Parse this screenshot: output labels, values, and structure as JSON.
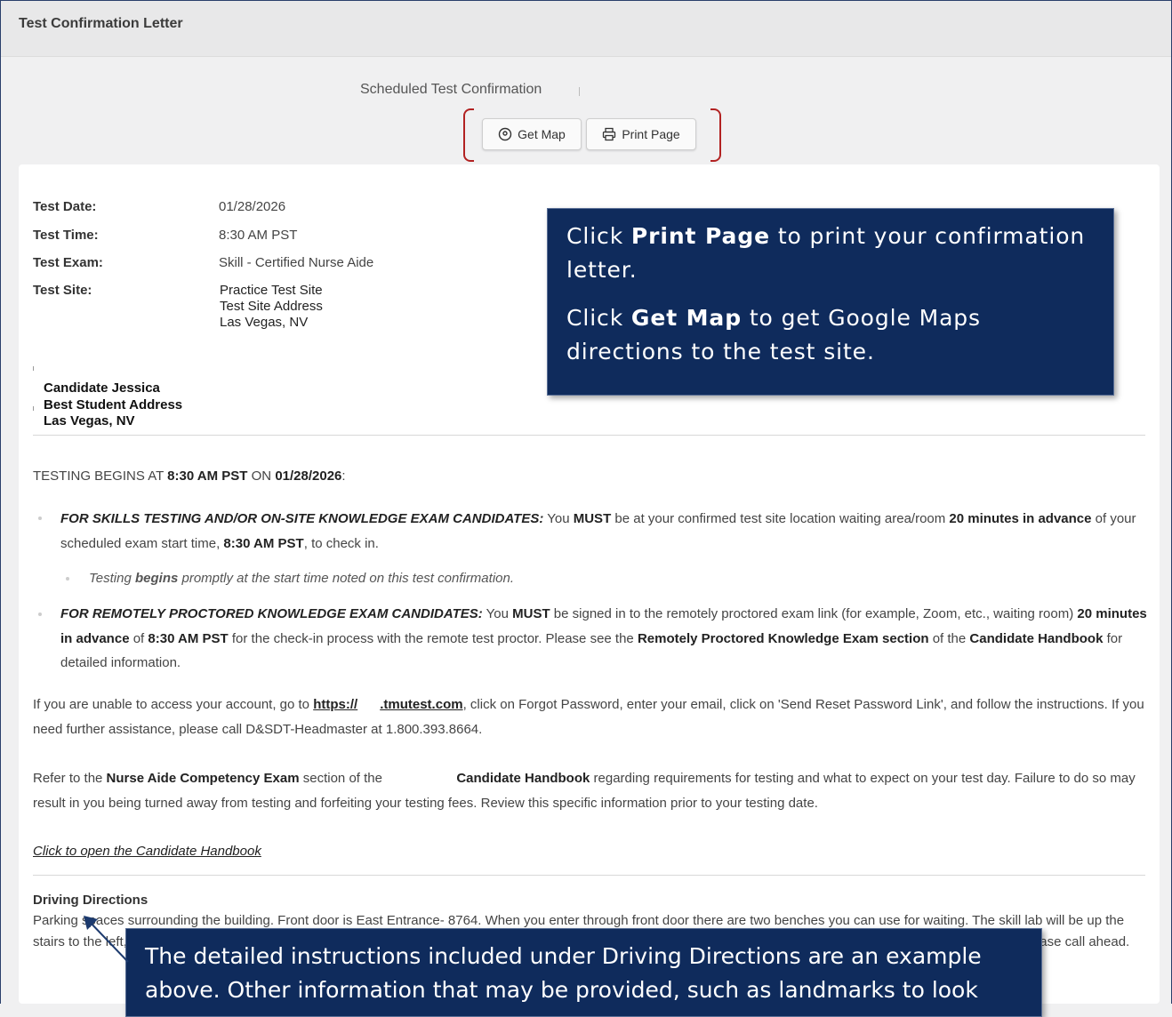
{
  "header": {
    "title": "Test Confirmation Letter"
  },
  "confirmation": {
    "subtitle": "Scheduled Test Confirmation",
    "get_map_label": "Get Map",
    "print_page_label": "Print Page"
  },
  "test_info": {
    "date_label": "Test Date:",
    "date_value": "01/28/2026",
    "time_label": "Test Time:",
    "time_value": "8:30 AM PST",
    "exam_label": "Test Exam:",
    "exam_value": "Skill - Certified Nurse Aide",
    "site_label": "Test Site:",
    "site_lines": [
      "Practice Test Site",
      "Test Site Address",
      "Las Vegas, NV"
    ]
  },
  "candidate": {
    "lines": [
      "Candidate Jessica",
      "Best Student Address",
      "Las Vegas, NV"
    ]
  },
  "testing": {
    "intro_prefix": "TESTING BEGINS AT ",
    "intro_time": "8:30 AM PST",
    "intro_mid": " ON ",
    "intro_date": "01/28/2026",
    "intro_suffix": ":",
    "b1_lead": "FOR SKILLS TESTING AND/OR ON-SITE KNOWLEDGE EXAM CANDIDATES:",
    "b1_t1": " You ",
    "b1_must": "MUST",
    "b1_t2": " be at your confirmed test site location waiting area/room ",
    "b1_adv": "20 minutes in advance",
    "b1_t3": " of your scheduled exam start time, ",
    "b1_time": "8:30 AM PST",
    "b1_t4": ", to check in.",
    "sub_t1": "Testing ",
    "sub_begins": "begins",
    "sub_t2": " promptly at the start time noted on this test confirmation.",
    "b2_lead": "FOR REMOTELY PROCTORED KNOWLEDGE EXAM CANDIDATES:",
    "b2_t1": " You ",
    "b2_must": "MUST",
    "b2_t2": " be signed in to the remotely proctored exam link (for example, Zoom, etc., waiting room) ",
    "b2_adv": "20 minutes in advance",
    "b2_t3": " of ",
    "b2_time": "8:30 AM PST",
    "b2_t4": " for the check-in process with the remote test proctor.  Please see the ",
    "b2_section": "Remotely Proctored Knowledge Exam section",
    "b2_t5": " of the ",
    "b2_handbook": "Candidate Handbook",
    "b2_t6": " for detailed information."
  },
  "account": {
    "t1": "If you are unable to access your account, go to ",
    "link1": "https://",
    "gap": "      ",
    "link2": ".tmutest.com",
    "t2": ", click on Forgot Password, enter your email, click on 'Send Reset Password Link', and follow the instructions.  If you need further assistance, please call D&SDT-Headmaster at 1.800.393.8664."
  },
  "refer": {
    "t1": "Refer to the ",
    "b1": "Nurse Aide Competency Exam",
    "t2": " section of the",
    "gap": "                    ",
    "b2": "Candidate Handbook",
    "t3": " regarding requirements for testing and what to expect on your test day.  Failure to do so may result in you being turned away from testing and forfeiting your testing fees.  Review this specific information prior to your testing date."
  },
  "handbook_link": "Click to open the Candidate Handbook",
  "driving": {
    "title": "Driving Directions",
    "text": "Parking spaces surrounding the building. Front door is East Entrance- 8764. When you enter through front door there are two benches you can use for waiting. The skill lab will be up the stairs to the left, there is a sign on the door. You will wait outside in the hallway until you are called in when it is your turn to test. ***If you need special accommodations please call ahead."
  },
  "callouts": {
    "c1_t1": "Click ",
    "c1_b1": "Print Page",
    "c1_t2": " to print your confirmation letter.",
    "c2_t1": "Click ",
    "c2_b1": "Get Map",
    "c2_t2": " to get Google Maps directions to the test site.",
    "c3_text": "The detailed instructions included under Driving Directions are an example above. Other information that may be provided, such as landmarks to look"
  }
}
